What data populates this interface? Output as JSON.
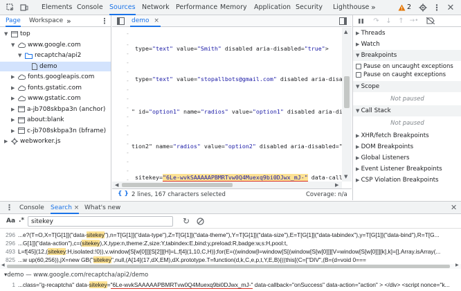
{
  "toolbar": {
    "tabs": [
      "Elements",
      "Console",
      "Sources",
      "Network",
      "Performance",
      "Memory",
      "Application",
      "Security",
      "Lighthouse"
    ],
    "more": "»",
    "warning_count": "2"
  },
  "navigator": {
    "tabs": [
      "Page",
      "Workspace",
      "»"
    ],
    "tree": [
      {
        "label": "top",
        "depth": 0,
        "type": "frame",
        "open": true
      },
      {
        "label": "www.google.com",
        "depth": 1,
        "type": "cloud",
        "open": true
      },
      {
        "label": "recaptcha/api2",
        "depth": 2,
        "type": "folder",
        "open": true
      },
      {
        "label": "demo",
        "depth": 3,
        "type": "file",
        "selected": true
      },
      {
        "label": "fonts.googleapis.com",
        "depth": 1,
        "type": "cloud",
        "open": false
      },
      {
        "label": "fonts.gstatic.com",
        "depth": 1,
        "type": "cloud",
        "open": false
      },
      {
        "label": "www.gstatic.com",
        "depth": 1,
        "type": "cloud",
        "open": false
      },
      {
        "label": "a-jb708skbpa3n (anchor)",
        "depth": 1,
        "type": "frame",
        "open": false
      },
      {
        "label": "about:blank",
        "depth": 1,
        "type": "frame",
        "open": false
      },
      {
        "label": "c-jb708skbpa3n (bframe)",
        "depth": 1,
        "type": "frame",
        "open": false
      },
      {
        "label": "webworker.js",
        "depth": 0,
        "type": "gear",
        "open": false
      }
    ]
  },
  "editor": {
    "file_tab": "demo",
    "close": "×",
    "lines": [
      {
        "segs": [
          [
            "plain",
            " type="
          ],
          [
            "str",
            "\"text\""
          ],
          [
            "plain",
            " value="
          ],
          [
            "str",
            "\"Smith\""
          ],
          [
            "plain",
            " disabled aria-disabled="
          ],
          [
            "str",
            "\"true\""
          ],
          [
            "plain",
            ">"
          ]
        ]
      },
      {
        "segs": [
          [
            "plain",
            " type="
          ],
          [
            "str",
            "\"text\""
          ],
          [
            "plain",
            " value="
          ],
          [
            "str",
            "\"stopallbots@gmail.com\""
          ],
          [
            "plain",
            " disabled aria-disab"
          ]
        ]
      },
      {
        "segs": [
          [
            "plain",
            "\" id="
          ],
          [
            "str",
            "\"option1\""
          ],
          [
            "plain",
            " name="
          ],
          [
            "str",
            "\"radios\""
          ],
          [
            "plain",
            " value="
          ],
          [
            "str",
            "\"option1\""
          ],
          [
            "plain",
            " disabled aria-dis"
          ]
        ]
      },
      {
        "segs": [
          [
            "plain",
            "tion2\" name="
          ],
          [
            "str",
            "\"radios\""
          ],
          [
            "plain",
            " value="
          ],
          [
            "str",
            "\"option2\""
          ],
          [
            "plain",
            " disabled aria-disabled=\"t"
          ]
        ]
      },
      {
        "segs": [
          [
            "plain",
            " sitekey="
          ],
          [
            "hlstr",
            "\"6Le-wvkSAAAAAPBMRTvw0Q4Muexq9bi0DJwx_mJ-\""
          ],
          [
            "plain",
            " data-callba"
          ]
        ]
      }
    ],
    "status_selected": "2 lines, 167 characters selected",
    "status_coverage": "Coverage: n/a"
  },
  "debugger": {
    "sections": [
      {
        "label": "Threads",
        "open": false
      },
      {
        "label": "Watch",
        "open": false
      },
      {
        "label": "Breakpoints",
        "open": true
      }
    ],
    "checkboxes": [
      "Pause on uncaught exceptions",
      "Pause on caught exceptions"
    ],
    "scope": "Scope",
    "not_paused": "Not paused",
    "call_stack": "Call Stack",
    "not_paused2": "Not paused",
    "more_sections": [
      "XHR/fetch Breakpoints",
      "DOM Breakpoints",
      "Global Listeners",
      "Event Listener Breakpoints",
      "CSP Violation Breakpoints"
    ]
  },
  "drawer": {
    "tabs": [
      "Console",
      "Search",
      "What's new"
    ],
    "aa": "Aa",
    "regex": ".*",
    "query": "sitekey",
    "results": [
      {
        "line": "296",
        "pre": "...e?(T=O,X=T[G[1]](\"data-",
        "kw": "sitekey",
        "post": "\"),n=T[G[1]](\"data-type\"),Z=T[G[1]](\"data-theme\"),Y=T[G[1]](\"data-size\"),E=T[G[1]](\"data-tabindex\"),y=T[G[1]](\"data-bind\"),R=T[G..."
      },
      {
        "line": "296",
        "pre": "...G[1]](\"data-action\"),c=(",
        "kw": "sitekey",
        "post": "),X,type:n,theme:Z,size:Y,tabindex:E,bind:y,preload:R,badge:w,s:H,pool:t,"
      },
      {
        "line": "493",
        "pre": "L=f[45](12,(",
        "kw": "sitekey",
        "post": ":H,isolated:!0)),v.window[S[w[0]]][S[2]][H]=L,f[4](1,10,C,H)};for(E=((window[l=window[S[(window[S[w[0]]][V=window[S[w[0]]][k],k]=[],Array.isArray(..."
      },
      {
        "line": "825",
        "pre": "...w up(60,256)),jX=new GB(\"",
        "kw": "sitekey",
        "post": "\",null,(A[14](17,dX,EM),dX.prototype.T=function(d,k,C,e,p,t,Y,E,B){((this[(C=[\"DIV\",(B=(d=void 0==="
      }
    ],
    "file_group": "▾demo — www.google.com/recaptcha/api2/demo",
    "file_result": {
      "line": "1",
      "pre": "...class=\"g-recaptcha\" data-",
      "kw": "sitekey",
      "post": "=\"6Le-wvkSAAAAAPBMRTvw0Q4Muexq9bi0DJwx_mJ-\" data-callback=\"onSuccess\" data-action=\"action\" > </div> <script nonce=\"k..."
    }
  }
}
